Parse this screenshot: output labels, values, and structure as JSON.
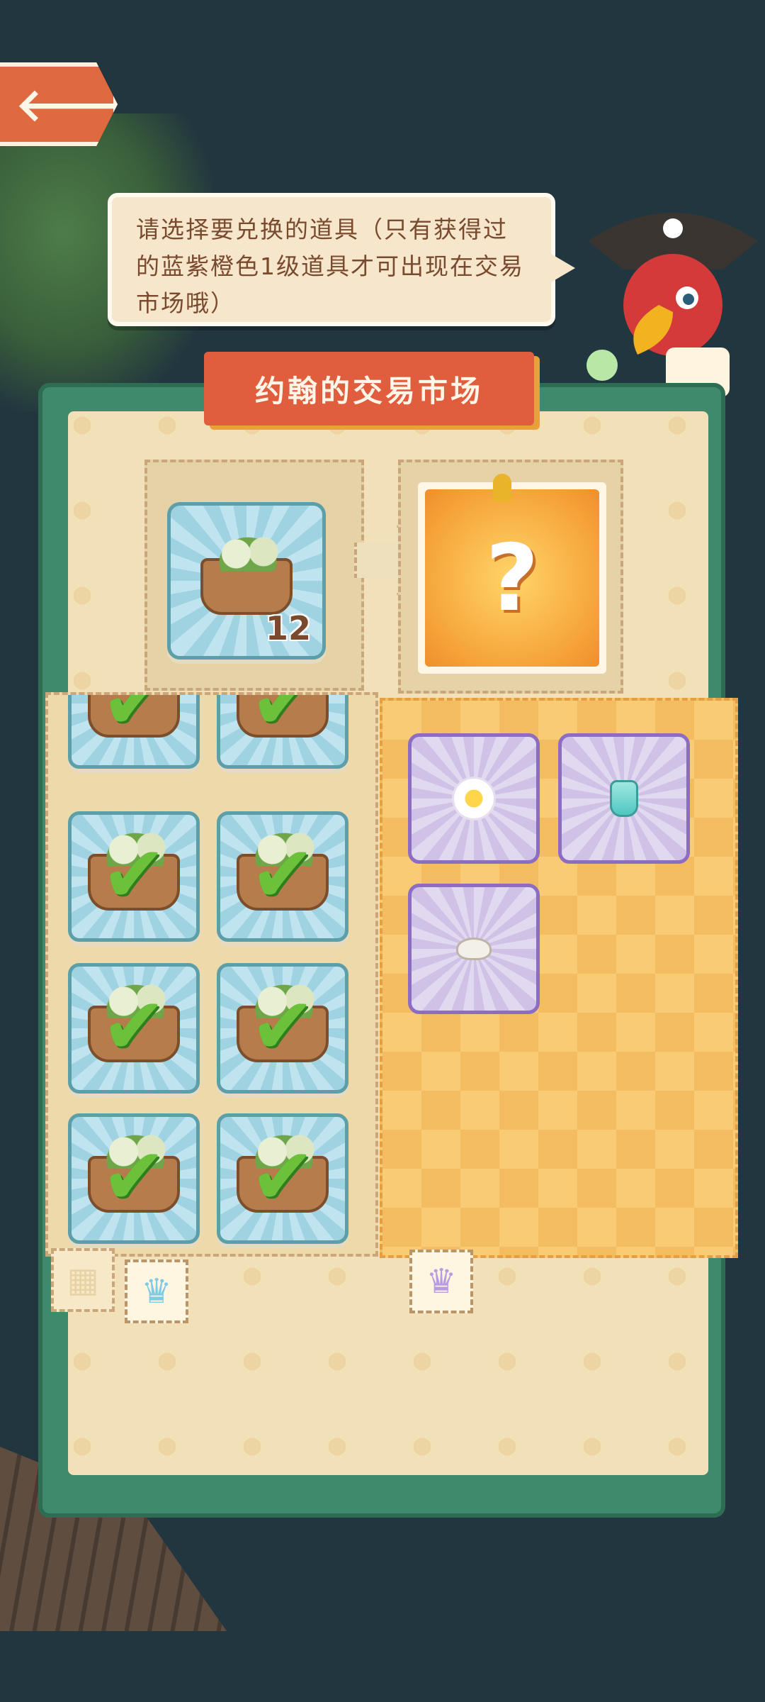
{
  "header": {
    "back_icon": "arrow-left-icon",
    "speech_text": "请选择要兑换的道具（只有获得过的蓝紫橙色1级道具才可出现在交易市场哦）"
  },
  "panel": {
    "title": "约翰的交易市场"
  },
  "exchange": {
    "source_count": "12",
    "result_symbol": "?"
  },
  "inventory": {
    "items": [
      {
        "name": "coconut-basket",
        "selected": true
      },
      {
        "name": "coconut-basket",
        "selected": true
      },
      {
        "name": "coconut-basket",
        "selected": true
      },
      {
        "name": "coconut-basket",
        "selected": true
      },
      {
        "name": "coconut-basket",
        "selected": true
      },
      {
        "name": "coconut-basket",
        "selected": true
      },
      {
        "name": "coconut-basket",
        "selected": true
      },
      {
        "name": "coconut-basket",
        "selected": true
      }
    ]
  },
  "rewards": {
    "items": [
      "plumeria-flower",
      "message-bottle",
      "seashell"
    ]
  },
  "tabs": {
    "grid_icon": "grid-icon",
    "blue_crown_icon": "crown-icon",
    "purple_crown_icon": "crown-icon"
  },
  "colors": {
    "background": "#21363f",
    "panel_green": "#3f8a6c",
    "title_red": "#e05d3d",
    "check_green": "#6bc23a"
  }
}
